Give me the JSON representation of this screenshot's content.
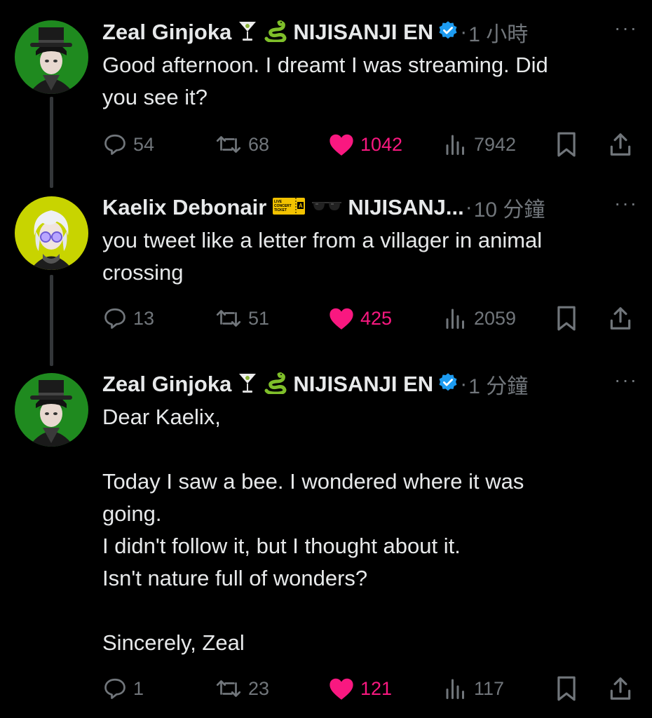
{
  "tweets": [
    {
      "name": "Zeal Ginjoka",
      "emoji": [
        "cocktail-glass",
        "snake"
      ],
      "org": "NIJISANJI EN",
      "verified": true,
      "separator": "·",
      "time": "1 小時",
      "text": "Good afternoon. I dreamt I was streaming. Did\nyou see it?",
      "replies": "54",
      "retweets": "68",
      "likes": "1042",
      "views": "7942"
    },
    {
      "name": "Kaelix Debonair",
      "emoji": [
        "concert-ticket",
        "sunglasses"
      ],
      "org": "NIJISANJ...",
      "verified": false,
      "separator": "·",
      "time": "10 分鐘",
      "text": "you tweet like a letter from a villager in animal\ncrossing",
      "replies": "13",
      "retweets": "51",
      "likes": "425",
      "views": "2059"
    },
    {
      "name": "Zeal Ginjoka",
      "emoji": [
        "cocktail-glass",
        "snake"
      ],
      "org": "NIJISANJI EN",
      "verified": true,
      "separator": "·",
      "time": "1 分鐘",
      "text": "Dear Kaelix,\n\nToday I saw a bee. I wondered where it was\ngoing.\nI didn't follow it, but I thought about it.\nIsn't nature full of wonders?\n\nSincerely, Zeal",
      "replies": "1",
      "retweets": "23",
      "likes": "121",
      "views": "117"
    }
  ],
  "ticket_text": [
    "LIVE",
    "CONCERT",
    "TICKET",
    "A"
  ],
  "more_label": "···",
  "colors": {
    "background": "#000000",
    "text": "#e7e9ea",
    "muted": "#71767b",
    "like": "#f91880",
    "verified": "#1d9bf0",
    "avatar_zeal_bg": "#1f8a1f",
    "avatar_kaelix_bg": "#c8d400"
  }
}
